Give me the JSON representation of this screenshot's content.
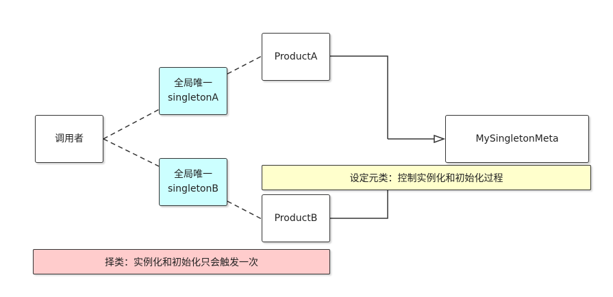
{
  "nodes": {
    "caller": "调用者",
    "singleton_a_line1": "全局唯一",
    "singleton_a_line2": "singletonA",
    "singleton_b_line1": "全局唯一",
    "singleton_b_line2": "singletonB",
    "product_a": "ProductA",
    "product_b": "ProductB",
    "meta": "MySingletonMeta"
  },
  "notes": {
    "metaclass": "设定元类：控制实例化和初始化过程",
    "selection": "择类：实例化和初始化只会触发一次"
  },
  "colors": {
    "singleton_fill": "#ccffff",
    "metaclass_note_fill": "#ffffcc",
    "selection_note_fill": "#ffcccc",
    "stroke": "#333333"
  }
}
